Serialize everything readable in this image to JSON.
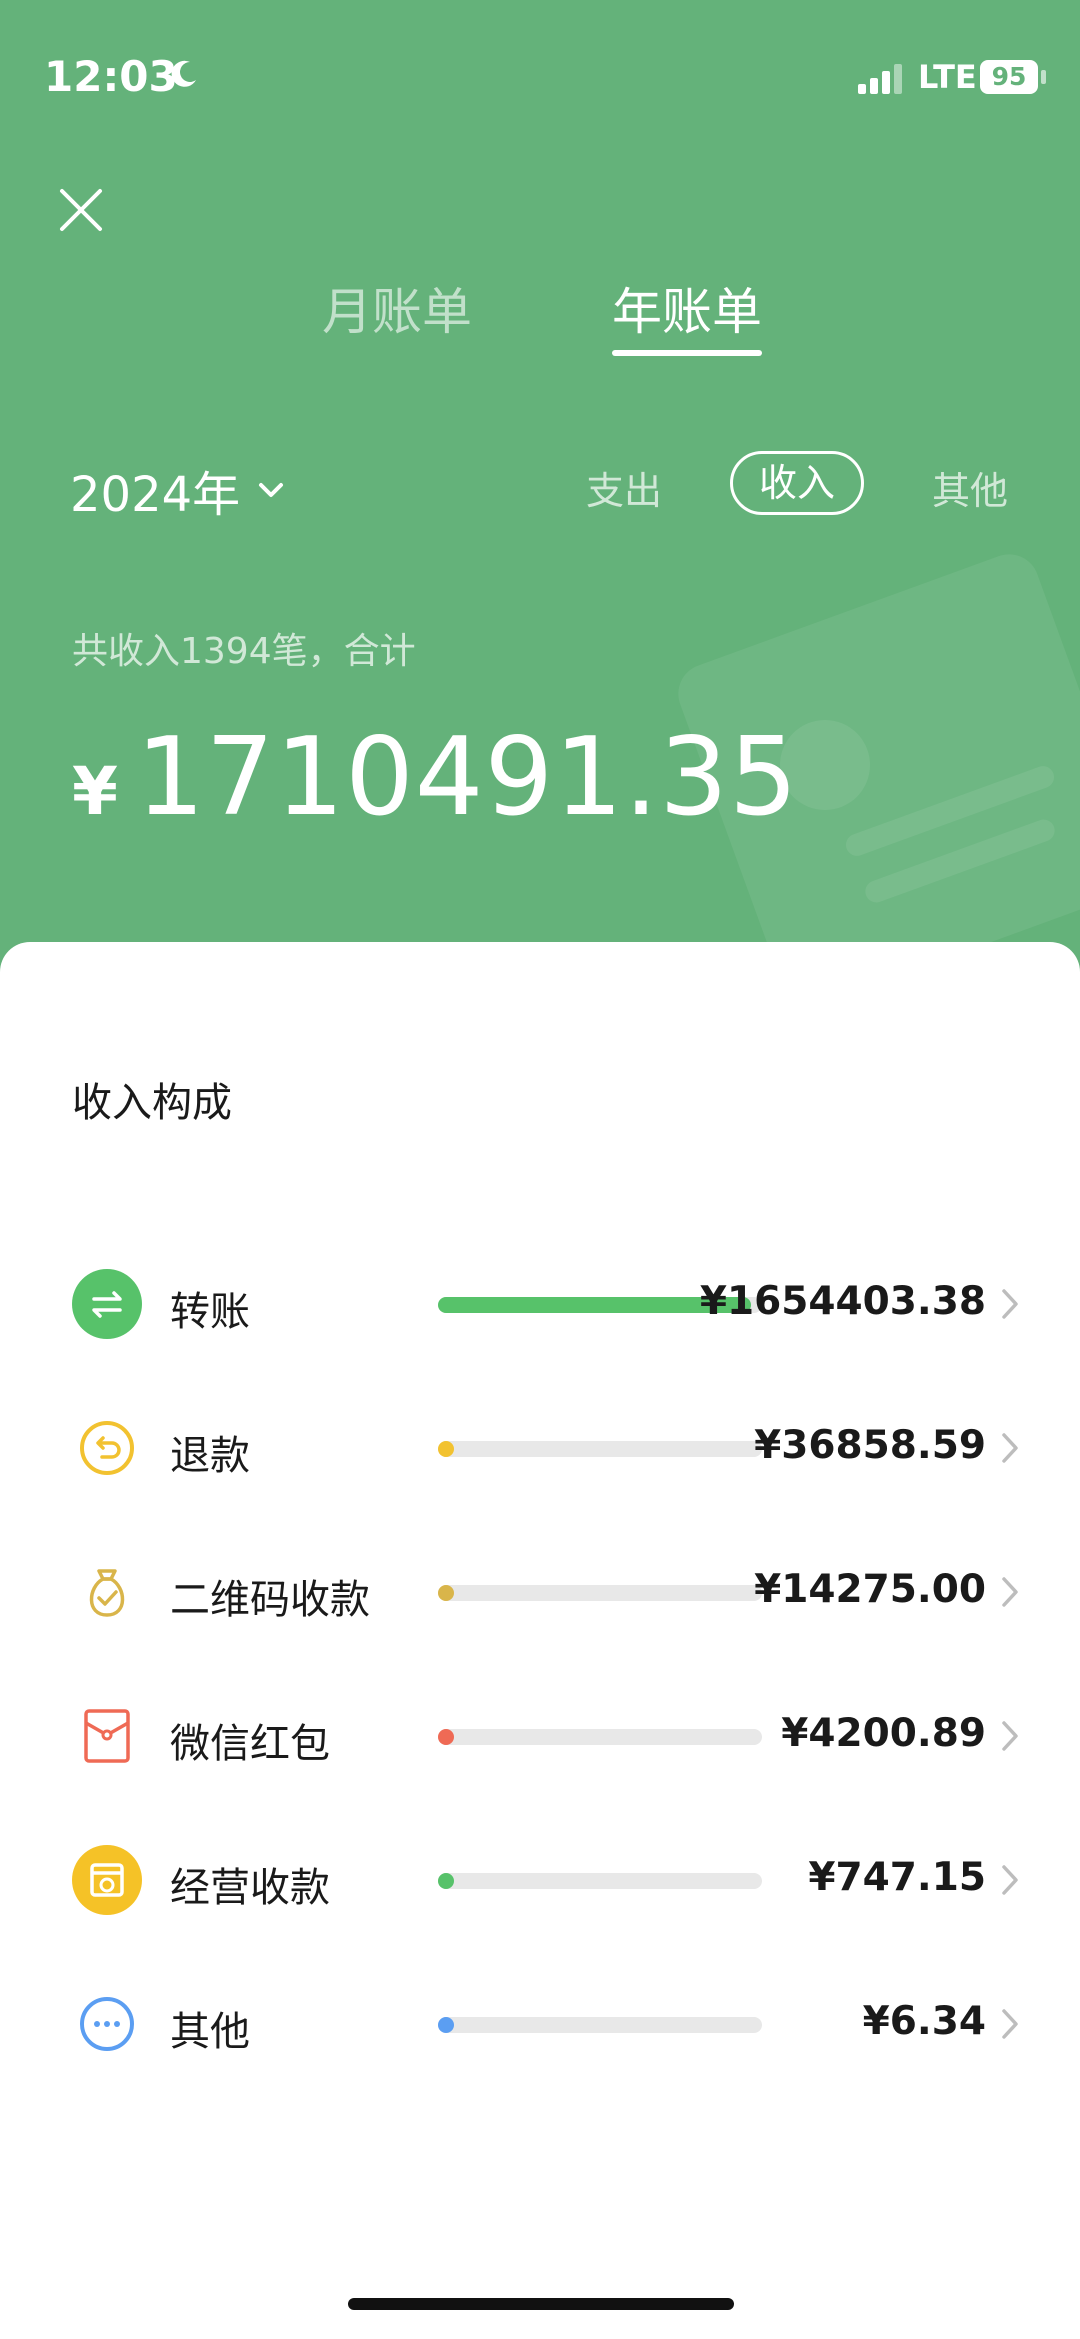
{
  "status": {
    "time": "12:03",
    "network": "LTE",
    "battery": "95"
  },
  "tabs": {
    "month": "月账单",
    "year": "年账单"
  },
  "year_picker": "2024年",
  "filters": {
    "expense": "支出",
    "income": "收入",
    "other": "其他"
  },
  "summary": {
    "text": "共收入1394笔，合计",
    "yen": "¥",
    "amount": "1710491.35"
  },
  "section_title": "收入构成",
  "items": [
    {
      "label": "转账",
      "amount": "¥1654403.38",
      "share": 0.967,
      "color": "#57c26a",
      "icon": "transfer-icon"
    },
    {
      "label": "退款",
      "amount": "¥36858.59",
      "share": 0.0,
      "color": "#f2c230",
      "icon": "refund-icon"
    },
    {
      "label": "二维码收款",
      "amount": "¥14275.00",
      "share": 0.0,
      "color": "#d9b54a",
      "icon": "money-bag-icon"
    },
    {
      "label": "微信红包",
      "amount": "¥4200.89",
      "share": 0.0,
      "color": "#ef6a55",
      "icon": "red-envelope-icon"
    },
    {
      "label": "经营收款",
      "amount": "¥747.15",
      "share": 0.0,
      "color": "#57c26a",
      "icon": "store-icon"
    },
    {
      "label": "其他",
      "amount": "¥6.34",
      "share": 0.0,
      "color": "#5b9ef2",
      "icon": "more-icon"
    }
  ]
}
